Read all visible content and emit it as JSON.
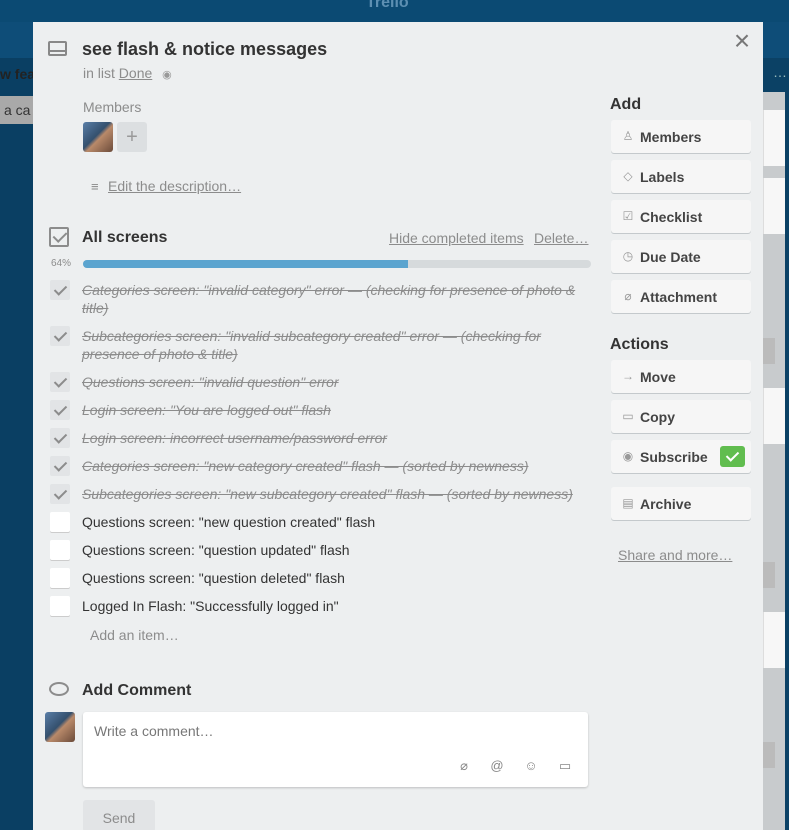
{
  "board": {
    "logo": "Trello",
    "left_list_title": "w feat",
    "left_card_text": "a ca"
  },
  "card": {
    "title": "see flash & notice messages",
    "in_list_prefix": "in list",
    "list_name": "Done",
    "members_label": "Members",
    "add_member_label": "+",
    "description_link": "Edit the description…"
  },
  "checklist": {
    "title": "All screens",
    "hide_completed_label": "Hide completed items",
    "delete_label": "Delete…",
    "progress_label": "64%",
    "progress_fraction": 0.64,
    "items": [
      {
        "text": "Categories screen: \"invalid category\" error — (checking for presence of photo & title)",
        "done": true
      },
      {
        "text": "Subcategories screen: \"invalid subcategory created\" error — (checking for presence of photo & title)",
        "done": true
      },
      {
        "text": "Questions screen: \"invalid question\" error",
        "done": true
      },
      {
        "text": "Login screen: \"You are logged out\" flash",
        "done": true
      },
      {
        "text": "Login screen: incorrect username/password error",
        "done": true
      },
      {
        "text": "Categories screen: \"new category created\" flash — (sorted by newness)",
        "done": true
      },
      {
        "text": "Subcategories screen: \"new subcategory created\" flash — (sorted by newness)",
        "done": true
      },
      {
        "text": "Questions screen: \"new question created\" flash",
        "done": false
      },
      {
        "text": "Questions screen: \"question updated\" flash",
        "done": false
      },
      {
        "text": "Questions screen: \"question deleted\" flash",
        "done": false
      },
      {
        "text": "Logged In Flash: \"Successfully logged in\"",
        "done": false
      }
    ],
    "add_item_label": "Add an item…"
  },
  "comment": {
    "title": "Add Comment",
    "placeholder": "Write a comment…",
    "send_label": "Send"
  },
  "sidebar": {
    "add_title": "Add",
    "add_buttons": [
      {
        "label": "Members",
        "icon": "person-icon"
      },
      {
        "label": "Labels",
        "icon": "tag-icon"
      },
      {
        "label": "Checklist",
        "icon": "checkbox-icon"
      },
      {
        "label": "Due Date",
        "icon": "clock-icon"
      },
      {
        "label": "Attachment",
        "icon": "paperclip-icon"
      }
    ],
    "actions_title": "Actions",
    "action_buttons": [
      {
        "label": "Move",
        "icon": "arrow-right-icon"
      },
      {
        "label": "Copy",
        "icon": "card-icon"
      },
      {
        "label": "Subscribe",
        "icon": "eye-icon",
        "checked": true
      },
      {
        "label": "Archive",
        "icon": "archive-icon"
      }
    ],
    "share_label": "Share and more…"
  },
  "colors": {
    "progress": "#5ba4cf",
    "subscribed": "#61bd4f",
    "modal_bg": "#edeff0"
  }
}
